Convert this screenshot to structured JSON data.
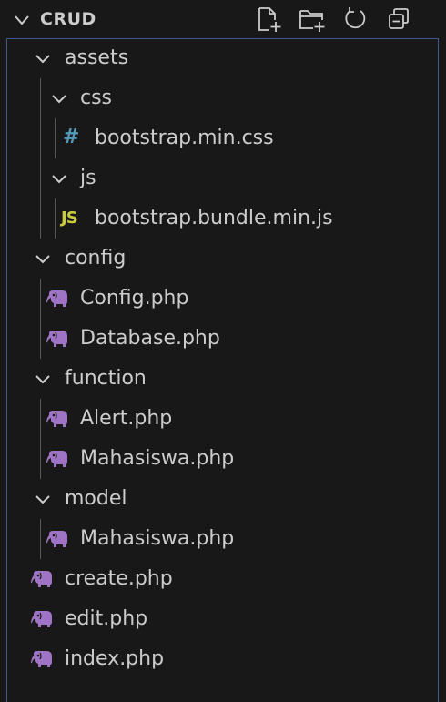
{
  "explorer": {
    "title": "CRUD",
    "actions": {
      "new_file": "new-file",
      "new_folder": "new-folder",
      "refresh": "refresh",
      "collapse": "collapse-all"
    }
  },
  "tree": {
    "assets": "assets",
    "css": "css",
    "bootstrap_css": "bootstrap.min.css",
    "js": "js",
    "bootstrap_js": "bootstrap.bundle.min.js",
    "js_badge": "JS",
    "css_badge": "#",
    "config": "config",
    "config_php": "Config.php",
    "database_php": "Database.php",
    "function": "function",
    "alert_php": "Alert.php",
    "function_mahasiswa_php": "Mahasiswa.php",
    "model": "model",
    "model_mahasiswa_php": "Mahasiswa.php",
    "create_php": "create.php",
    "edit_php": "edit.php",
    "index_php": "index.php"
  },
  "colors": {
    "php_icon": "#a074c4",
    "css_icon": "#519aba",
    "js_icon": "#cbcb41",
    "focus_border": "#3c5a8c"
  }
}
